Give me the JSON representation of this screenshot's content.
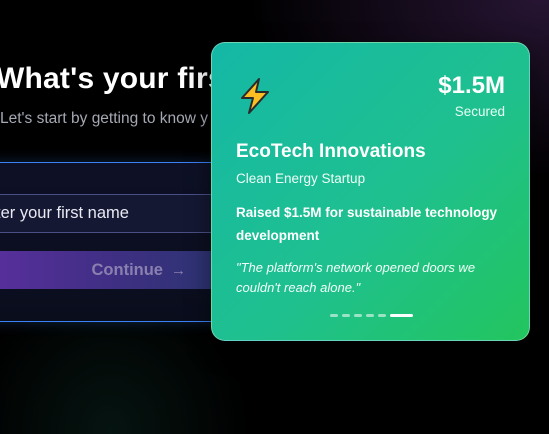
{
  "form": {
    "heading": "What's your firs",
    "subtitle": "Let's start by getting to know y",
    "name_placeholder": "ter your first name",
    "continue_label": "Continue",
    "continue_arrow": "→"
  },
  "card": {
    "amount": "$1.5M",
    "amount_caption": "Secured",
    "company": "EcoTech Innovations",
    "category": "Clean Energy Startup",
    "headline": "Raised $1.5M for sustainable technology development",
    "quote": "\"The platform's network opened doors we couldn't reach alone.\"",
    "icon": "lightning-bolt-icon",
    "carousel": {
      "total": 6,
      "active_index": 5
    }
  },
  "colors": {
    "card_gradient_start": "#14b8a6",
    "card_gradient_end": "#22c55e",
    "form_border": "#3b82f6",
    "button_gradient_start": "#5b2f9f",
    "icon_fill": "#fbbf24"
  }
}
